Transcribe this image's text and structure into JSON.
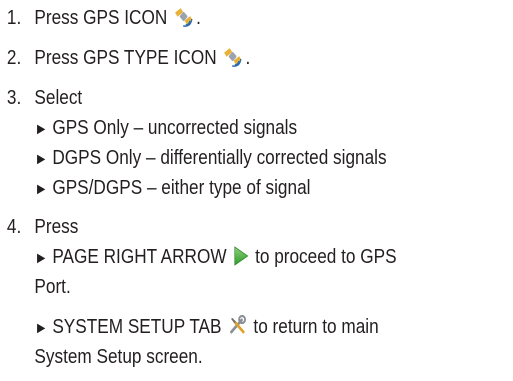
{
  "steps": [
    {
      "number": "1.",
      "text_before": "Press GPS ICON",
      "text_after": "."
    },
    {
      "number": "2.",
      "text_before": "Press GPS TYPE ICON",
      "text_after": "."
    },
    {
      "number": "3.",
      "text": "Select",
      "options": [
        "GPS Only – uncorrected signals",
        "DGPS Only – differentially corrected signals",
        "GPS/DGPS – either type of signal"
      ]
    },
    {
      "number": "4.",
      "text": "Press",
      "bullets": [
        {
          "before": "PAGE RIGHT ARROW",
          "after": "to proceed to GPS",
          "continuation": "Port."
        },
        {
          "before": "SYSTEM SETUP TAB",
          "after": "to return to main",
          "continuation": "System Setup screen."
        }
      ]
    }
  ],
  "bullet_glyph": "►",
  "icons": {
    "gps": "satellite-icon",
    "page_right": "green-right-arrow-icon",
    "system_setup": "wrench-screwdriver-icon"
  },
  "colors": {
    "text": "#231f20",
    "arrow_green": "#3aa935",
    "satellite_gold": "#e8b23a"
  }
}
